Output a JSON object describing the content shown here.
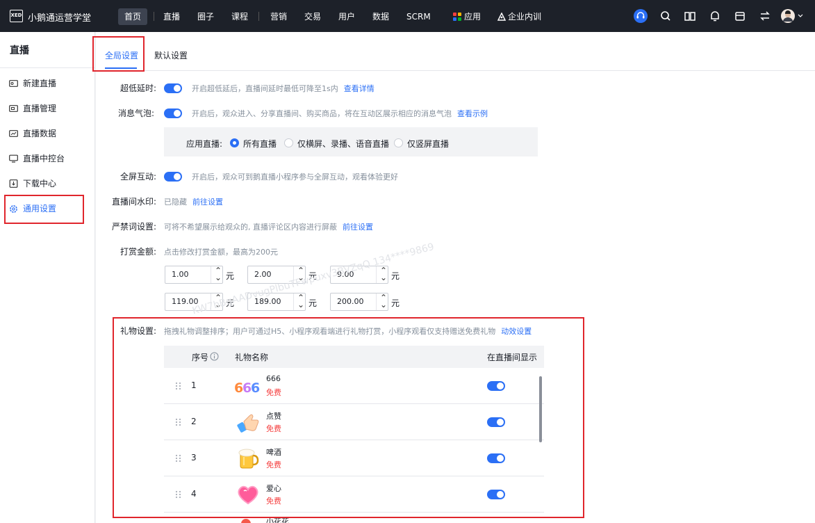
{
  "app": {
    "logo_text": "XED",
    "name": "小鹅通运营学堂"
  },
  "nav": [
    "首页",
    "直播",
    "圈子",
    "课程",
    "营销",
    "交易",
    "用户",
    "数据",
    "SCRM",
    "应用",
    "企业内训"
  ],
  "nav_active": "首页",
  "toolbar_icons": [
    "headset-icon",
    "search-icon",
    "book-icon",
    "bell-icon",
    "store-icon",
    "switch-icon",
    "avatar"
  ],
  "sidebar": {
    "title": "直播",
    "items": [
      "新建直播",
      "直播管理",
      "直播数据",
      "直播中控台",
      "下载中心",
      "通用设置"
    ],
    "icons": [
      "video-icon",
      "manage-icon",
      "data-icon",
      "console-icon",
      "download-icon",
      "gear-icon"
    ],
    "active": "通用设置"
  },
  "tabs": [
    "全局设置",
    "默认设置"
  ],
  "active_tab": "全局设置",
  "settings": {
    "low_latency": {
      "label": "超低延时:",
      "enabled": true,
      "desc": "开启超低延后，直播间延时最低可降至1s内",
      "link": "查看详情"
    },
    "bubble": {
      "label": "消息气泡:",
      "enabled": true,
      "desc": "开启后，观众进入、分享直播间、购买商品，将在互动区展示相应的消息气泡",
      "link": "查看示例"
    },
    "apply": {
      "label": "应用直播:",
      "options": [
        "所有直播",
        "仅横屏、录播、语音直播",
        "仅竖屏直播"
      ],
      "selected": "所有直播"
    },
    "fullscreen": {
      "label": "全屏互动:",
      "enabled": true,
      "desc": "开启后，观众可到鹅直播小程序参与全屏互动，观看体验更好"
    },
    "watermark": {
      "label": "直播间水印:",
      "status": "已隐藏",
      "link": "前往设置"
    },
    "banned": {
      "label": "严禁词设置:",
      "desc": "可将不希望展示给观众的, 直播评论区内容进行屏蔽",
      "link": "前往设置"
    },
    "tip": {
      "label": "打赏金额:",
      "desc": "点击修改打赏金额，最高为200元",
      "amounts": [
        "1.00",
        "2.00",
        "9.00",
        "119.00",
        "189.00",
        "200.00"
      ],
      "unit": "元"
    },
    "gift": {
      "label": "礼物设置:",
      "desc": "拖拽礼物调整排序；用户可通过H5、小程序观看端进行礼物打赏，小程序观看仅支持赠送免费礼物",
      "link": "动效设置"
    }
  },
  "gift_table": {
    "headers": [
      "序号",
      "礼物名称",
      "在直播间显示"
    ],
    "rows": [
      {
        "seq": "1",
        "name": "666",
        "price": "免费",
        "shown": true
      },
      {
        "seq": "2",
        "name": "点赞",
        "price": "免费",
        "shown": true
      },
      {
        "seq": "3",
        "name": "啤酒",
        "price": "免费",
        "shown": true
      },
      {
        "seq": "4",
        "name": "爱心",
        "price": "免费",
        "shown": true
      },
      {
        "seq": "",
        "name": "小花花",
        "price": "",
        "shown": true
      }
    ]
  },
  "watermark_text": "KW7bBgAADvugPlbuTFwpuxv3BVZqQ 134****9869",
  "colors": {
    "primary": "#2b6ff5",
    "topbar": "#1d2129",
    "highlight": "#e0252c",
    "price": "#f53f3f"
  }
}
